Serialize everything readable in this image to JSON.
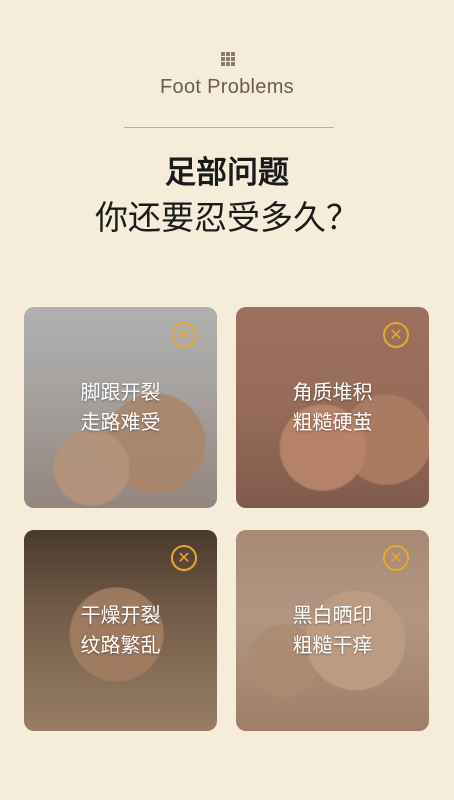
{
  "header": {
    "subtitle": "Foot Problems",
    "headline_line1": "足部问题",
    "headline_line2": "你还要忍受多久？"
  },
  "cards": [
    {
      "line1": "脚跟开裂",
      "line2": "走路难受",
      "badge_icon": "close-circle-icon"
    },
    {
      "line1": "角质堆积",
      "line2": "粗糙硬茧",
      "badge_icon": "close-circle-icon"
    },
    {
      "line1": "干燥开裂",
      "line2": "纹路繁乱",
      "badge_icon": "close-circle-icon"
    },
    {
      "line1": "黑白晒印",
      "line2": "粗糙干痒",
      "badge_icon": "close-circle-icon"
    }
  ],
  "colors": {
    "background": "#f6ecda",
    "accent": "#e6a82d",
    "divider": "#d8a77a"
  }
}
